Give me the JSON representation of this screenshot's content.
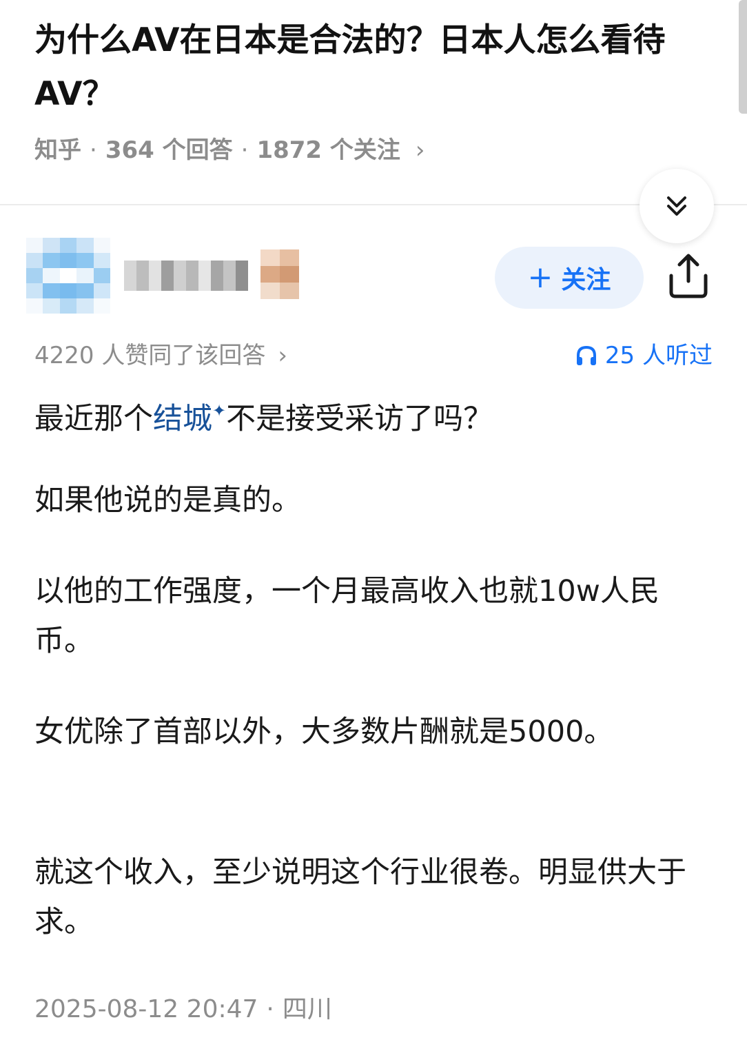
{
  "question": {
    "title": "为什么AV在日本是合法的？日本人怎么看待AV？",
    "source": "知乎",
    "answers_count": "364 个回答",
    "followers_count": "1872 个关注",
    "separator": "·",
    "chevron": "›"
  },
  "author": {
    "follow_label": "关注",
    "follow_icon": "+"
  },
  "answer": {
    "votes_text": "4220 人赞同了该回答",
    "listen_text": "25 人听过",
    "paragraphs": {
      "p1_before": "最近那个",
      "p1_link": "结城",
      "p1_link_mark": "✦",
      "p1_after": "不是接受采访了吗？",
      "p2": "如果他说的是真的。",
      "p3": "以他的工作强度，一个月最高收入也就10w人民币。",
      "p4": "女优除了首部以外，大多数片酬就是5000。",
      "p5": "就这个收入，至少说明这个行业很卷。明显供大于求。"
    },
    "date": "2025-08-12 20:47",
    "location": "四川",
    "dot": "·"
  },
  "colors": {
    "accent": "#1772f6",
    "link": "#175199",
    "meta_gray": "#8c8c8c",
    "follow_bg": "#ebf2fc"
  },
  "icons": {
    "collapse": "double-chevron-down-icon",
    "share": "share-icon",
    "listen": "headphones-icon"
  }
}
